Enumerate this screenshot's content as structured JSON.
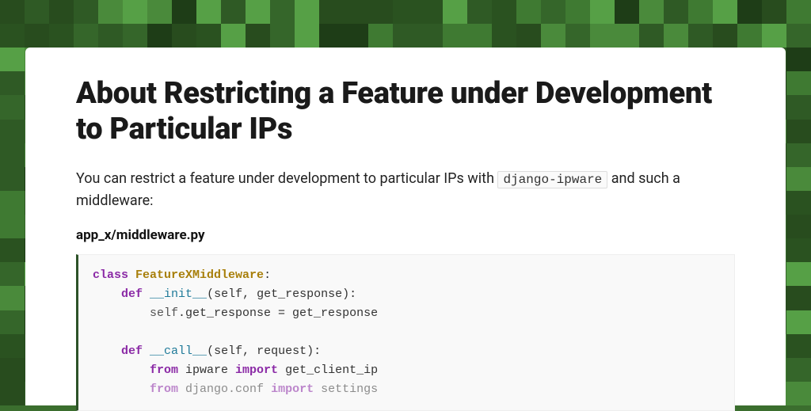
{
  "article": {
    "title": "About Restricting a Feature under Development to Particular IPs",
    "intro_before": "You can restrict a feature under development to particular IPs with ",
    "intro_inline_code": "django-ipware",
    "intro_after": " and such a middleware:",
    "filename": "app_x/middleware.py"
  },
  "code": {
    "l1": {
      "kw": "class",
      "cls": "FeatureXMiddleware",
      "rest": ":"
    },
    "l2": {
      "indent": "    ",
      "kw": "def",
      "fn": "__init__",
      "rest": "(self, get_response):"
    },
    "l3": {
      "indent": "        ",
      "self": "self",
      "rest": ".get_response = get_response"
    },
    "l4": "",
    "l5": {
      "indent": "    ",
      "kw": "def",
      "fn": "__call__",
      "rest": "(self, request):"
    },
    "l6": {
      "indent": "        ",
      "kw1": "from",
      "mod": " ipware ",
      "kw2": "import",
      "rest": " get_client_ip"
    },
    "l7": {
      "indent": "        ",
      "kw1": "from",
      "mod": " django.conf ",
      "kw2": "import",
      "rest": " settings"
    }
  }
}
